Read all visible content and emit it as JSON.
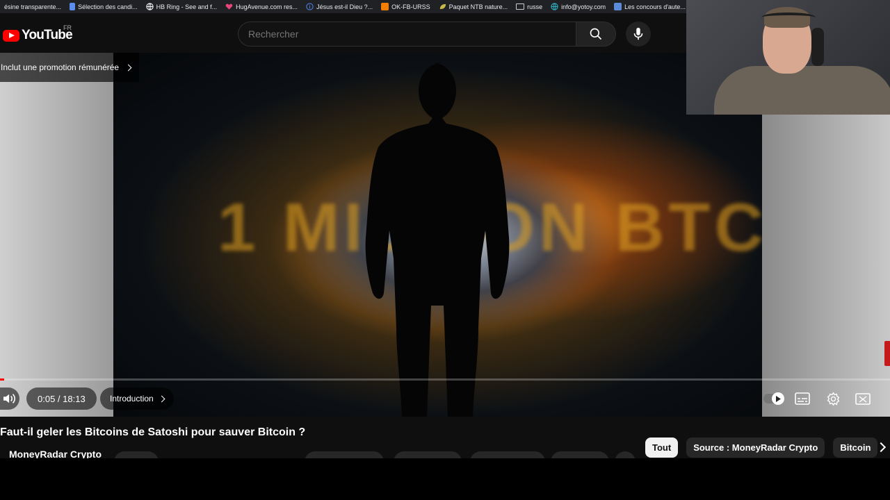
{
  "bookmarks": [
    {
      "label": "ésine transparente...",
      "icon": "none",
      "color": ""
    },
    {
      "label": "Sélection des candi...",
      "icon": "doc-icon",
      "color": "#5b8def"
    },
    {
      "label": "HB Ring - See and f...",
      "icon": "globe-icon",
      "color": "#ffffff"
    },
    {
      "label": "HugAvenue.com res...",
      "icon": "heart-icon",
      "color": "#e8457a"
    },
    {
      "label": "Jésus est-il Dieu ?...",
      "icon": "info-icon",
      "color": "#4a7bd8"
    },
    {
      "label": "OK-FB-URSS",
      "icon": "blogger-icon",
      "color": "#f57d00"
    },
    {
      "label": "Paquet NTB nature...",
      "icon": "leaf-icon",
      "color": "#c8b84a"
    },
    {
      "label": "russe",
      "icon": "folder-icon",
      "color": ""
    },
    {
      "label": "info@yotoy.com",
      "icon": "globe-icon",
      "color": "#2fb6c8"
    },
    {
      "label": "Les concours d'aute...",
      "icon": "image-icon",
      "color": "#5a8bd8"
    }
  ],
  "header": {
    "logo_text": "YouTube",
    "country_code": "FR",
    "search_placeholder": "Rechercher"
  },
  "player": {
    "promo_label": "Inclut une promotion rémunérée",
    "thumbnail_text": "1 MILLION BTC",
    "time": "0:05 / 18:13",
    "chapter": "Introduction",
    "progress": 0.0046
  },
  "video": {
    "title": "Faut-il geler les Bitcoins de Satoshi pour sauver Bitcoin ?",
    "channel": "MoneyRadar Crypto"
  },
  "chips": [
    "Tout",
    "Source : MoneyRadar Crypto",
    "Bitcoin"
  ],
  "colors": {
    "brand_red": "#ff0000",
    "background": "#0f0f0f"
  }
}
